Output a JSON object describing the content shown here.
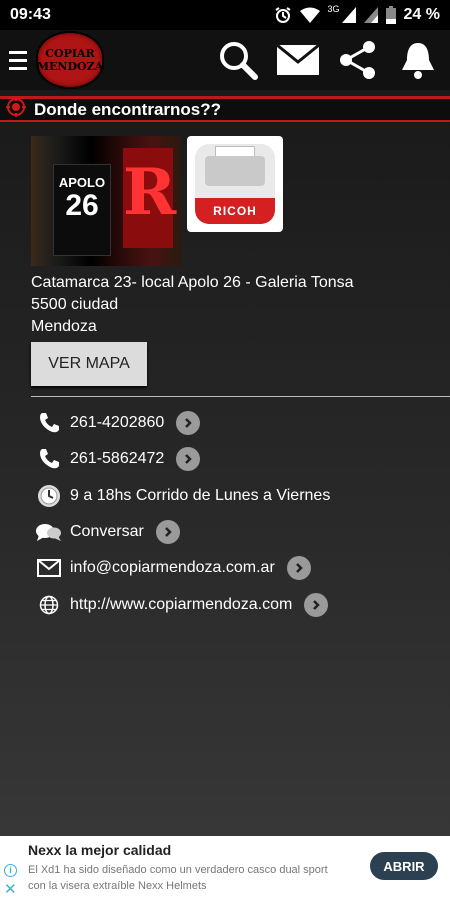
{
  "status_bar": {
    "time": "09:43",
    "network": "3G",
    "battery": "24 %"
  },
  "app_bar": {
    "logo_line1": "COPIAR",
    "logo_line2": "MENDOZA",
    "icons": [
      "menu-icon",
      "search-icon",
      "mail-icon",
      "share-icon",
      "bell-icon"
    ]
  },
  "section": {
    "title": "Donde encontrarnos??"
  },
  "photos": {
    "store_sign_top": "APOLO",
    "store_sign_number": "26",
    "store_letter": "R",
    "printer_brand": "RICOH"
  },
  "address": {
    "line1": "Catamarca 23- local Apolo 26 - Galeria Tonsa",
    "line2": "5500 ciudad",
    "line3": "Mendoza"
  },
  "map_button": "VER MAPA",
  "contacts": [
    {
      "icon": "phone-icon",
      "text": "261-4202860",
      "chevron": true
    },
    {
      "icon": "phone-icon",
      "text": "261-5862472",
      "chevron": true
    },
    {
      "icon": "clock-icon",
      "text": "9 a 18hs Corrido de Lunes a Viernes",
      "chevron": false
    },
    {
      "icon": "chat-icon",
      "text": "Conversar",
      "chevron": true
    },
    {
      "icon": "mail-icon",
      "text": "info@copiarmendoza.com.ar",
      "chevron": true
    },
    {
      "icon": "globe-icon",
      "text": "http://www.copiarmendoza.com",
      "chevron": true
    }
  ],
  "ad": {
    "title": "Nexx la mejor calidad",
    "text": "El Xd1 ha sido diseñado como un verdadero casco dual sport con la visera extraíble Nexx Helmets",
    "button": "ABRIR"
  },
  "colors": {
    "accent": "#c01818",
    "background": "#1e1e1e",
    "button": "#dcdcdc",
    "ad_button": "#2b4152"
  }
}
